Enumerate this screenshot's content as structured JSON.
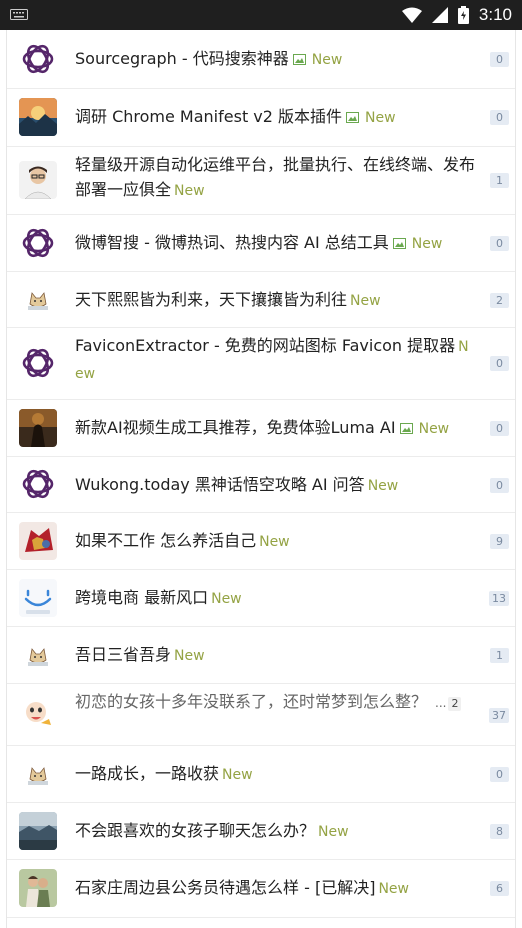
{
  "status": {
    "time": "3:10"
  },
  "rows": [
    {
      "title": "Sourcegraph - 代码搜索神器",
      "image": true,
      "new": "New",
      "count": "0",
      "avatar": "openai"
    },
    {
      "title": "调研 Chrome Manifest v2 版本插件",
      "image": true,
      "new": "New",
      "count": "0",
      "avatar": "sunset"
    },
    {
      "title": "轻量级开源自动化运维平台，批量执行、在线终端、发布部署一应俱全",
      "image": false,
      "new": "New",
      "count": "1",
      "avatar": "person-cartoon"
    },
    {
      "title": "微博智搜 - 微博热词、热搜内容 AI 总结工具",
      "image": true,
      "new": "New",
      "count": "0",
      "avatar": "openai"
    },
    {
      "title": "天下熙熙皆为利来，天下攘攘皆为利往",
      "image": false,
      "new": "New",
      "count": "2",
      "avatar": "cat"
    },
    {
      "title": "FaviconExtractor - 免费的网站图标 Favicon 提取器",
      "image": false,
      "new": "New",
      "count": "0",
      "avatar": "openai"
    },
    {
      "title": "新款AI视频生成工具推荐，免费体验Luma AI",
      "image": true,
      "new": "New",
      "count": "0",
      "avatar": "dark-photo"
    },
    {
      "title": "Wukong.today 黑神话悟空攻略 AI 问答",
      "image": false,
      "new": "New",
      "count": "0",
      "avatar": "openai"
    },
    {
      "title": "如果不工作 怎么养活自己",
      "image": false,
      "new": "New",
      "count": "9",
      "avatar": "ironman"
    },
    {
      "title": "跨境电商 最新风口",
      "image": false,
      "new": "New",
      "count": "13",
      "avatar": "smiley"
    },
    {
      "title": "吾日三省吾身",
      "image": false,
      "new": "New",
      "count": "1",
      "avatar": "cat"
    },
    {
      "title": "初恋的女孩十多年没联系了，还时常梦到怎么整？",
      "image": false,
      "new": "",
      "count": "37",
      "avatar": "cartoon-baby",
      "pages_ellipsis": "...",
      "pages_num": "2"
    },
    {
      "title": "一路成长，一路收获",
      "image": false,
      "new": "New",
      "count": "0",
      "avatar": "cat"
    },
    {
      "title": "不会跟喜欢的女孩子聊天怎么办？",
      "image": false,
      "new": "New",
      "count": "8",
      "avatar": "landscape"
    },
    {
      "title": "石家庄周边县公务员待遇怎么样 - [已解决]",
      "image": false,
      "new": "New",
      "count": "6",
      "avatar": "couple"
    }
  ]
}
